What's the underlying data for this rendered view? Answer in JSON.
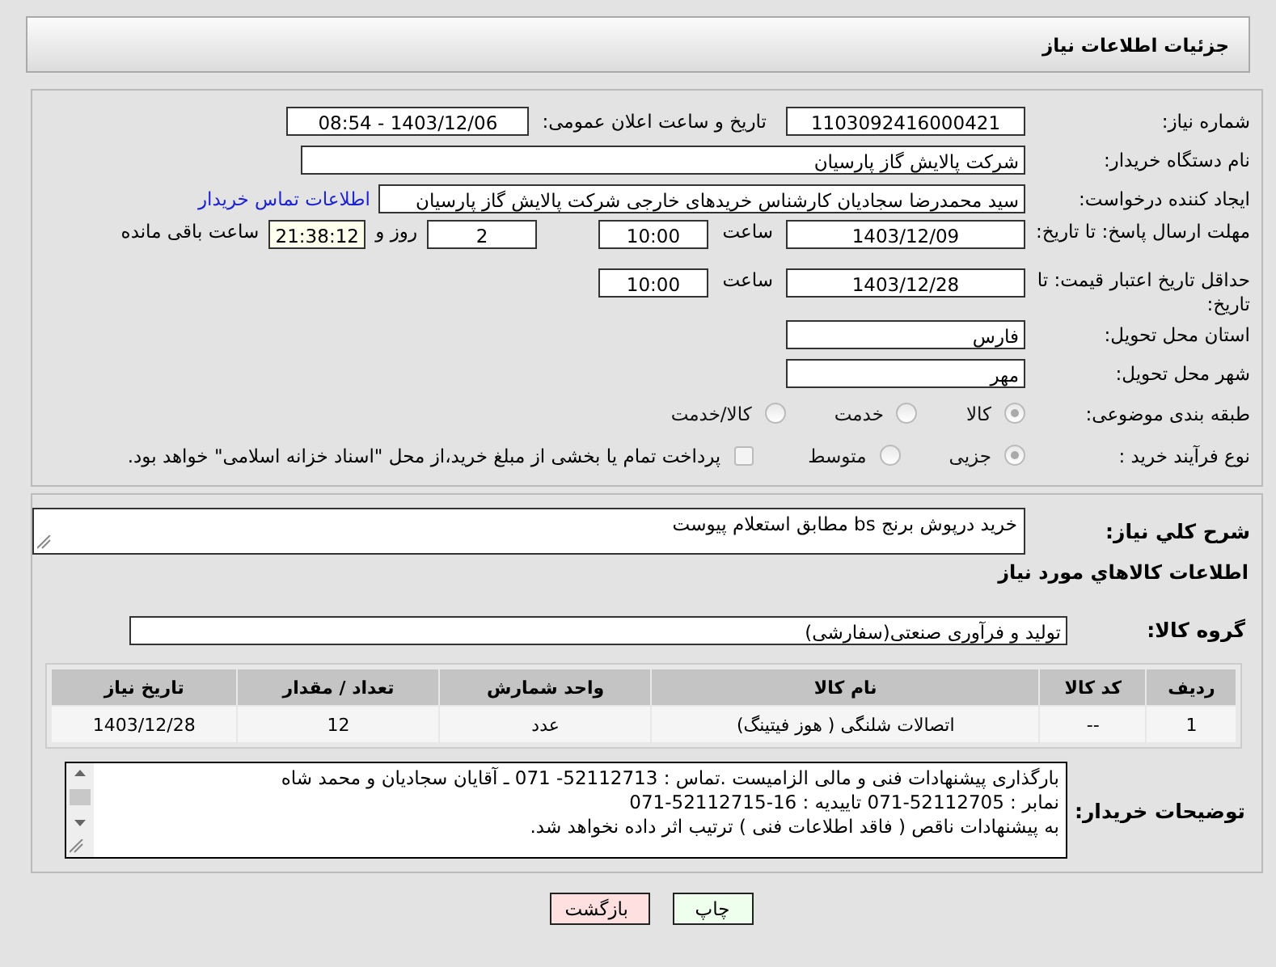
{
  "header": {
    "title": "جزئیات اطلاعات نیاز"
  },
  "need_number": {
    "label": "شماره نیاز:",
    "value": "1103092416000421"
  },
  "announce": {
    "label": "تاریخ و ساعت اعلان عمومی:",
    "value": "1403/12/06 - 08:54"
  },
  "buyer_org": {
    "label": "نام دستگاه خریدار:",
    "value": "شرکت پالایش گاز پارسیان"
  },
  "requester": {
    "label": "ایجاد کننده درخواست:",
    "value": "سید محمدرضا سجادیان کارشناس خریدهای خارجی شرکت پالایش گاز پارسیان",
    "link": "اطلاعات تماس خریدار"
  },
  "deadline": {
    "label": "مهلت ارسال پاسخ: تا تاریخ:",
    "date": "1403/12/09",
    "time_label": "ساعت",
    "time": "10:00",
    "days": "2",
    "days_label": "روز و",
    "remaining": "21:38:12",
    "remaining_label": "ساعت باقی مانده"
  },
  "price_validity": {
    "label": "حداقل تاریخ اعتبار قیمت: تا تاریخ:",
    "date": "1403/12/28",
    "time_label": "ساعت",
    "time": "10:00"
  },
  "province": {
    "label": "استان محل تحویل:",
    "value": "فارس"
  },
  "city": {
    "label": "شهر محل تحویل:",
    "value": "مهر"
  },
  "category": {
    "label": "طبقه بندی موضوعی:",
    "options": [
      {
        "label": "کالا",
        "selected": true
      },
      {
        "label": "خدمت",
        "selected": false
      },
      {
        "label": "کالا/خدمت",
        "selected": false
      }
    ]
  },
  "process": {
    "label": "نوع فرآیند خرید :",
    "options": [
      {
        "label": "جزیی",
        "selected": true
      },
      {
        "label": "متوسط",
        "selected": false
      }
    ],
    "treasury": {
      "checked": false,
      "text": "پرداخت تمام یا بخشی از مبلغ خرید،از محل \"اسناد خزانه اسلامی\" خواهد بود."
    }
  },
  "description": {
    "label": "شرح کلي نياز:",
    "value": "خرید درپوش برنج bs  مطابق استعلام پیوست"
  },
  "goods_title": "اطلاعات کالاهاي مورد نياز",
  "goods_group": {
    "label": "گروه کالا:",
    "value": "تولید و فرآوری صنعتی(سفارشی)"
  },
  "table": {
    "columns": [
      "ردیف",
      "کد کالا",
      "نام کالا",
      "واحد شمارش",
      "تعداد / مقدار",
      "تاریخ نیاز"
    ],
    "rows": [
      [
        "1",
        "--",
        "اتصالات شلنگی ( هوز فیتینگ)",
        "عدد",
        "12",
        "1403/12/28"
      ]
    ]
  },
  "buyer_notes": {
    "label": "توضیحات خریدار:",
    "lines": [
      "بارگذاری پیشنهادات فنی و مالی الزامیست .تماس : 52112713- 071 ـ آقایان سجادیان و محمد شاه",
      "نمابر : 52112705-071 تاییدیه : 16-52112715-071",
      "به پیشنهادات ناقص ( فاقد اطلاعات فنی ) ترتیب اثر داده نخواهد شد."
    ]
  },
  "buttons": [
    {
      "kind": "print",
      "label": "چاپ"
    },
    {
      "kind": "back",
      "label": "بازگشت"
    }
  ]
}
